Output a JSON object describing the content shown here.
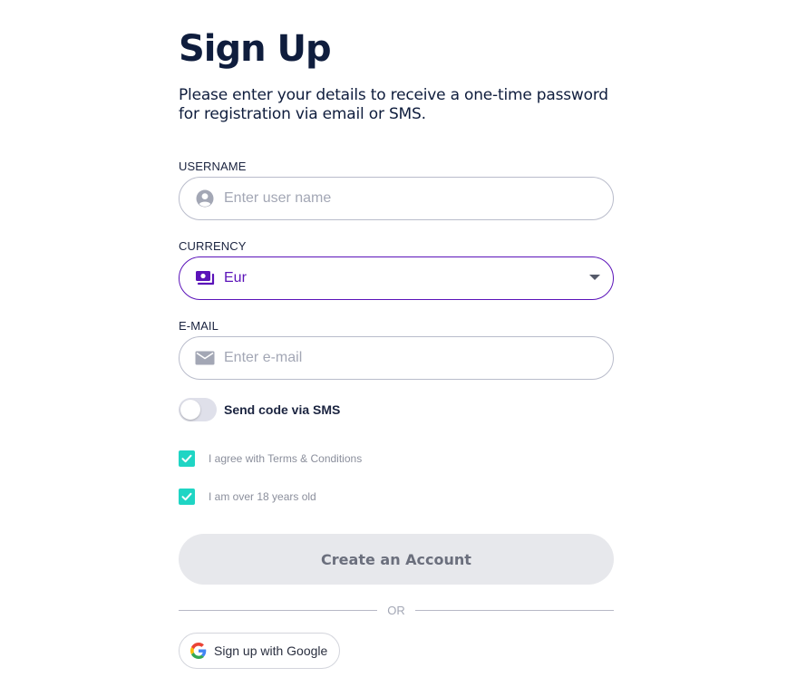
{
  "page": {
    "title": "Sign Up",
    "subtitle": "Please enter your details to receive a one-time password for registration via email or SMS."
  },
  "username": {
    "label": "USERNAME",
    "placeholder": "Enter user name",
    "value": ""
  },
  "currency": {
    "label": "CURRENCY",
    "selected": "Eur"
  },
  "email": {
    "label": "E-MAIL",
    "placeholder": "Enter e-mail",
    "value": ""
  },
  "sms_toggle": {
    "label": "Send code via SMS",
    "on": false
  },
  "checkboxes": [
    {
      "label": "I agree with Terms & Conditions",
      "checked": true
    },
    {
      "label": "I am over 18 years old",
      "checked": true
    }
  ],
  "create_button": {
    "label": "Create an Account"
  },
  "divider": {
    "label": "OR"
  },
  "google_button": {
    "label": "Sign up with Google"
  },
  "icons": {
    "username": "user-circle-icon",
    "currency": "money-icon",
    "email": "envelope-icon",
    "dropdown": "caret-down-icon",
    "google": "google-g-icon",
    "check": "checkmark-icon"
  },
  "colors": {
    "title": "#0f1d3d",
    "accent": "#5b13b9",
    "checkbox": "#1fd5c4",
    "disabled_button_bg": "#e7e8ec",
    "disabled_button_text": "#6b6f7d",
    "placeholder": "#a3a7b5"
  }
}
